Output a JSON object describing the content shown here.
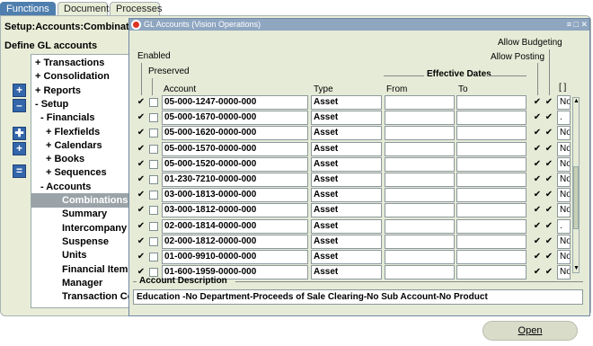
{
  "tabs": [
    "Functions",
    "Documents",
    "Processes"
  ],
  "navigator": {
    "path": "Setup:Accounts:Combination",
    "heading": "Define GL accounts",
    "tree": [
      {
        "label": "+ Transactions",
        "indent": 0
      },
      {
        "label": "+ Consolidation",
        "indent": 0
      },
      {
        "label": "+ Reports",
        "indent": 0
      },
      {
        "label": "- Setup",
        "indent": 0
      },
      {
        "label": "- Financials",
        "indent": 1
      },
      {
        "label": "+ Flexfields",
        "indent": 2
      },
      {
        "label": "+ Calendars",
        "indent": 2
      },
      {
        "label": "+ Books",
        "indent": 2
      },
      {
        "label": "+ Sequences",
        "indent": 2
      },
      {
        "label": "- Accounts",
        "indent": 1
      },
      {
        "label": "Combinations",
        "indent": 3,
        "selected": true
      },
      {
        "label": "Summary",
        "indent": 3
      },
      {
        "label": "Intercompany",
        "indent": 3
      },
      {
        "label": "Suspense",
        "indent": 3
      },
      {
        "label": "Units",
        "indent": 3
      },
      {
        "label": "Financial Items",
        "indent": 3
      },
      {
        "label": "Manager",
        "indent": 3
      },
      {
        "label": "Transaction Code",
        "indent": 3
      }
    ]
  },
  "window": {
    "title": "GL Accounts (Vision Operations)",
    "title_controls": "≡ □ ✕",
    "headers": {
      "enabled": "Enabled",
      "preserved": "Preserved",
      "allow_budgeting": "Allow Budgeting",
      "allow_posting": "Allow Posting",
      "effective_dates": "Effective Dates",
      "account": "Account",
      "type": "Type",
      "from": "From",
      "to": "To",
      "brackets": "[ ]"
    },
    "rows": [
      {
        "account": "05-000-1247-0000-000",
        "type": "Asset",
        "last": "No"
      },
      {
        "account": "05-000-1670-0000-000",
        "type": "Asset",
        "last": "."
      },
      {
        "account": "05-000-1620-0000-000",
        "type": "Asset",
        "last": "No"
      },
      {
        "account": "05-000-1570-0000-000",
        "type": "Asset",
        "last": "No"
      },
      {
        "account": "05-000-1520-0000-000",
        "type": "Asset",
        "last": "No"
      },
      {
        "account": "01-230-7210-0000-000",
        "type": "Asset",
        "last": "No"
      },
      {
        "account": "03-000-1813-0000-000",
        "type": "Asset",
        "last": "No"
      },
      {
        "account": "03-000-1812-0000-000",
        "type": "Asset",
        "last": "No"
      },
      {
        "account": "02-000-1814-0000-000",
        "type": "Asset",
        "last": "."
      },
      {
        "account": "02-000-1812-0000-000",
        "type": "Asset",
        "last": "No"
      },
      {
        "account": "01-000-9910-0000-000",
        "type": "Asset",
        "last": "No"
      },
      {
        "account": "01-600-1959-0000-000",
        "type": "Asset",
        "last": "No"
      }
    ],
    "description_label": "Account Description",
    "description_value": "Education -No Department-Proceeds of Sale Clearing-No Sub Account-No Product"
  },
  "open_button": "Open",
  "icons": {
    "tree_expand": "+",
    "tree_collapse": "–",
    "check": "✔"
  }
}
